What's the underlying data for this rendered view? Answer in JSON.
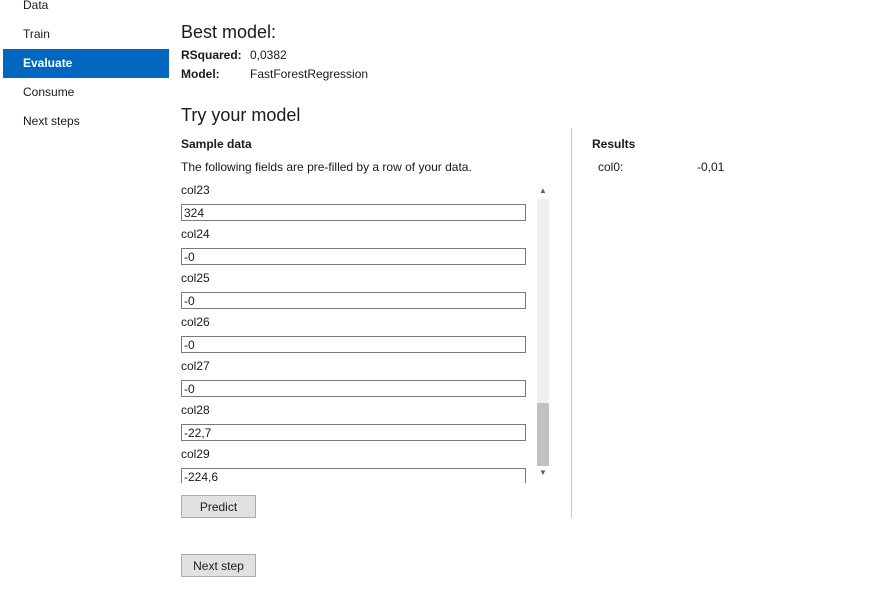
{
  "sidebar": {
    "items": [
      {
        "label": "Data"
      },
      {
        "label": "Train"
      },
      {
        "label": "Evaluate"
      },
      {
        "label": "Consume"
      },
      {
        "label": "Next steps"
      }
    ],
    "active": "Evaluate"
  },
  "best_model": {
    "title": "Best model:",
    "rsquared_label": "RSquared:",
    "rsquared_value": "0,0382",
    "model_label": "Model:",
    "model_value": "FastForestRegression"
  },
  "try_model": {
    "title": "Try your model",
    "sample_label": "Sample data",
    "description": "The following fields are pre-filled by a row of your data.",
    "fields": [
      {
        "label": "col23",
        "value": "324"
      },
      {
        "label": "col24",
        "value": "-0"
      },
      {
        "label": "col25",
        "value": "-0"
      },
      {
        "label": "col26",
        "value": "-0"
      },
      {
        "label": "col27",
        "value": "-0"
      },
      {
        "label": "col28",
        "value": "-22,7"
      },
      {
        "label": "col29",
        "value": "-224,6"
      }
    ],
    "predict_label": "Predict"
  },
  "results": {
    "title": "Results",
    "rows": [
      {
        "name": "col0:",
        "value": "-0,01"
      }
    ]
  },
  "footer": {
    "next_step_label": "Next step"
  },
  "colors": {
    "accent": "#0067c0"
  }
}
